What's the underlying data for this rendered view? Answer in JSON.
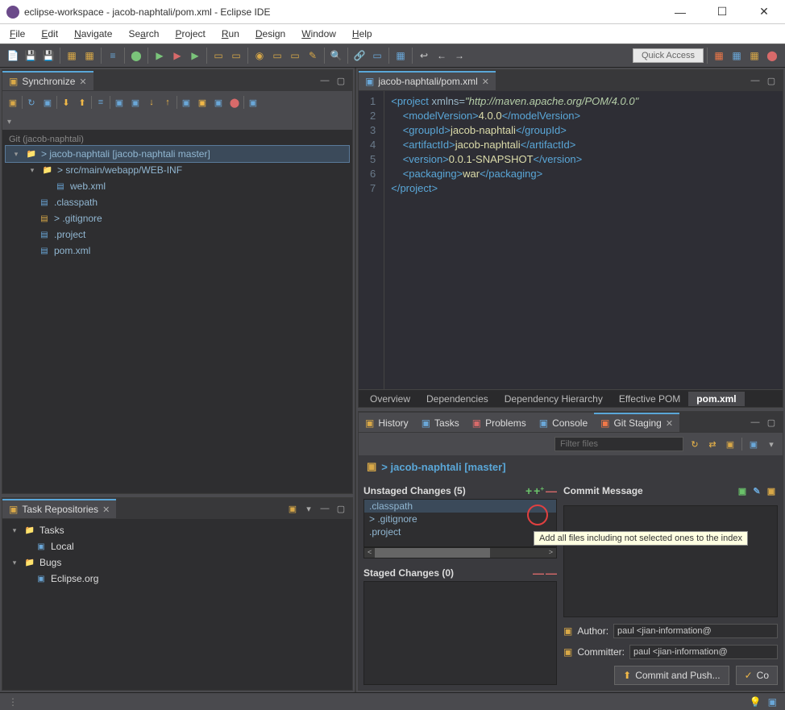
{
  "title": "eclipse-workspace - jacob-naphtali/pom.xml - Eclipse IDE",
  "window_controls": {
    "min": "—",
    "max": "☐",
    "close": "✕"
  },
  "menu": [
    "File",
    "Edit",
    "Navigate",
    "Search",
    "Project",
    "Run",
    "Design",
    "Window",
    "Help"
  ],
  "quick_access": "Quick Access",
  "views": {
    "synchronize": {
      "tab": "Synchronize",
      "repo_header": "Git (jacob-naphtali)",
      "root": "> jacob-naphtali [jacob-naphtali master]",
      "nodes": [
        "> src/main/webapp/WEB-INF",
        "web.xml",
        ".classpath",
        "> .gitignore",
        ".project",
        "pom.xml"
      ]
    },
    "task_repos": {
      "tab": "Task Repositories",
      "tasks": "Tasks",
      "local": "Local",
      "bugs": "Bugs",
      "eclipse": "Eclipse.org"
    },
    "editor": {
      "tab": "jacob-naphtali/pom.xml",
      "lines": [
        "1",
        "2",
        "3",
        "4",
        "5",
        "6",
        "7"
      ],
      "xml": {
        "ns": "http://maven.apache.org/POM/4.0.0",
        "modelVersion": "4.0.0",
        "groupId": "jacob-naphtali",
        "artifactId": "jacob-naphtali",
        "version": "0.0.1-SNAPSHOT",
        "packaging": "war"
      },
      "bottom_tabs": [
        "Overview",
        "Dependencies",
        "Dependency Hierarchy",
        "Effective POM",
        "pom.xml"
      ]
    },
    "bottom_tabs": [
      "History",
      "Tasks",
      "Problems",
      "Console",
      "Git Staging"
    ],
    "git_staging": {
      "filter_placeholder": "Filter files",
      "repo": "> jacob-naphtali [master]",
      "unstaged_header": "Unstaged Changes (5)",
      "unstaged": [
        ".classpath",
        "> .gitignore",
        ".project"
      ],
      "staged_header": "Staged Changes (0)",
      "commit_msg_header": "Commit Message",
      "author_label": "Author:",
      "author_value": "paul <jian-information@",
      "committer_label": "Committer:",
      "committer_value": "paul <jian-information@",
      "commit_push_btn": "Commit and Push...",
      "commit_btn": "Co",
      "tooltip": "Add all files including not selected ones to the index"
    }
  }
}
